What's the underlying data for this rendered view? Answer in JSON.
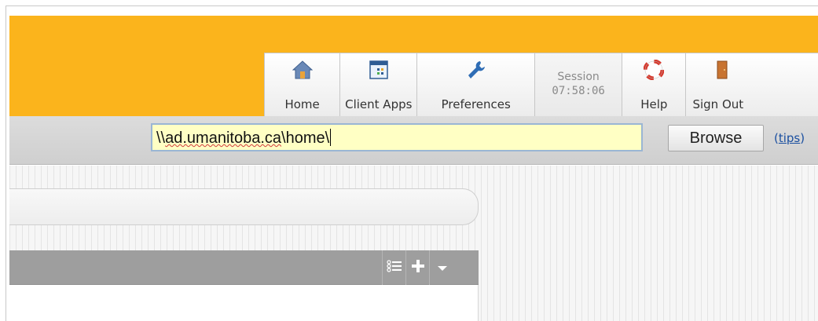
{
  "nav": {
    "home_label": "Home",
    "client_apps_label": "Client Apps",
    "preferences_label": "Preferences",
    "session_title": "Session",
    "session_time": "07:58:06",
    "help_label": "Help",
    "sign_out_label": "Sign Out"
  },
  "path": {
    "prefix": "\\\\",
    "domain": "ad.umanitoba.ca",
    "suffix": "\\home\\",
    "browse_label": "Browse",
    "tips_label": "tips"
  },
  "icons": {
    "home": "home-icon",
    "client_apps": "client-apps-icon",
    "preferences": "wrench-icon",
    "help": "lifebuoy-icon",
    "sign_out": "door-icon",
    "list": "list-icon",
    "add": "plus-icon",
    "dropdown": "chevron-down-icon"
  },
  "colors": {
    "header": "#fbb41c",
    "path_input_bg": "#ffffc4",
    "link": "#1a4fa0"
  }
}
